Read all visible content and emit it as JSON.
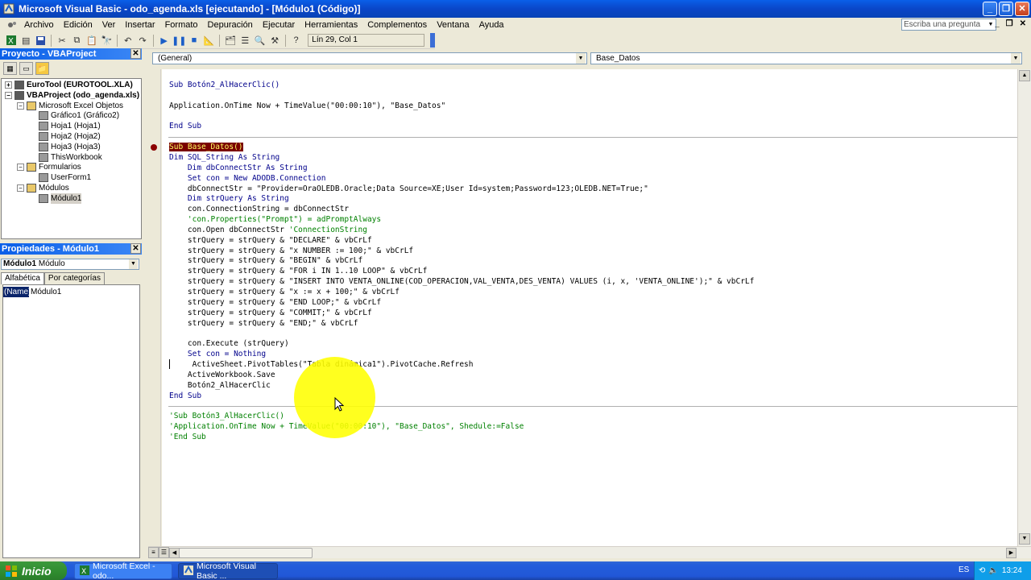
{
  "window": {
    "title": "Microsoft Visual Basic - odo_agenda.xls [ejecutando] - [Módulo1 (Código)]"
  },
  "menu": {
    "items": [
      "Archivo",
      "Edición",
      "Ver",
      "Insertar",
      "Formato",
      "Depuración",
      "Ejecutar",
      "Herramientas",
      "Complementos",
      "Ventana",
      "Ayuda"
    ],
    "ask_placeholder": "Escriba una pregunta"
  },
  "toolbar": {
    "position": "Lín 29, Col 1"
  },
  "project_panel": {
    "title": "Proyecto - VBAProject",
    "tree": [
      {
        "label": "EuroTool (EUROTOOL.XLA)",
        "level": 0,
        "bold": true,
        "expander": "+"
      },
      {
        "label": "VBAProject (odo_agenda.xls)",
        "level": 0,
        "bold": true,
        "expander": "−"
      },
      {
        "label": "Microsoft Excel Objetos",
        "level": 1,
        "expander": "−"
      },
      {
        "label": "Gráfico1 (Gráfico2)",
        "level": 2
      },
      {
        "label": "Hoja1 (Hoja1)",
        "level": 2
      },
      {
        "label": "Hoja2 (Hoja2)",
        "level": 2
      },
      {
        "label": "Hoja3 (Hoja3)",
        "level": 2
      },
      {
        "label": "ThisWorkbook",
        "level": 2
      },
      {
        "label": "Formularios",
        "level": 1,
        "expander": "−"
      },
      {
        "label": "UserForm1",
        "level": 2
      },
      {
        "label": "Módulos",
        "level": 1,
        "expander": "−"
      },
      {
        "label": "Módulo1",
        "level": 2,
        "selected": true
      }
    ]
  },
  "properties_panel": {
    "title": "Propiedades - Módulo1",
    "object_name": "Módulo1",
    "object_type": "Módulo",
    "tabs": [
      "Alfabética",
      "Por categorías"
    ],
    "rows": [
      {
        "name": "(Name)",
        "value": "Módulo1"
      }
    ]
  },
  "code_window": {
    "object_combo": "(General)",
    "proc_combo": "Base_Datos",
    "lines": [
      [
        {
          "t": "Sub Botón2_AlHacerClic()",
          "k": "kw"
        }
      ],
      [],
      [
        {
          "t": "Application.OnTime Now + TimeValue(\"00:00:10\"), \"Base_Datos\""
        }
      ],
      [],
      [
        {
          "t": "End Sub",
          "k": "kw"
        }
      ],
      [],
      [
        {
          "t": "Sub Base_Datos()",
          "k": "hl"
        }
      ],
      [
        {
          "t": "Dim SQL_String As String",
          "k": "kw"
        }
      ],
      [
        {
          "t": "    Dim dbConnectStr As String",
          "k": "kw"
        }
      ],
      [
        {
          "t": "    Set con = New ADODB.Connection",
          "k": "kw"
        }
      ],
      [
        {
          "t": "    dbConnectStr = \"Provider=OraOLEDB.Oracle;Data Source=XE;User Id=system;Password=123;OLEDB.NET=True;\""
        }
      ],
      [
        {
          "t": "    Dim strQuery As String",
          "k": "kw"
        }
      ],
      [
        {
          "t": "    con.ConnectionString = dbConnectStr"
        }
      ],
      [
        {
          "t": "    'con.Properties(\"Prompt\") = adPromptAlways",
          "k": "cm"
        }
      ],
      [
        {
          "t": "    con.Open dbConnectStr "
        },
        {
          "t": "'ConnectionString",
          "k": "cm"
        }
      ],
      [
        {
          "t": "    strQuery = strQuery & \"DECLARE\" & vbCrLf"
        }
      ],
      [
        {
          "t": "    strQuery = strQuery & \"x NUMBER := 100;\" & vbCrLf"
        }
      ],
      [
        {
          "t": "    strQuery = strQuery & \"BEGIN\" & vbCrLf"
        }
      ],
      [
        {
          "t": "    strQuery = strQuery & \"FOR i IN 1..10 LOOP\" & vbCrLf"
        }
      ],
      [
        {
          "t": "    strQuery = strQuery & \"INSERT INTO VENTA_ONLINE(COD_OPERACION,VAL_VENTA,DES_VENTA) VALUES (i, x, 'VENTA_ONLINE');\" & vbCrLf"
        }
      ],
      [
        {
          "t": "    strQuery = strQuery & \"x := x + 100;\" & vbCrLf"
        }
      ],
      [
        {
          "t": "    strQuery = strQuery & \"END LOOP;\" & vbCrLf"
        }
      ],
      [
        {
          "t": "    strQuery = strQuery & \"COMMIT;\" & vbCrLf"
        }
      ],
      [
        {
          "t": "    strQuery = strQuery & \"END;\" & vbCrLf"
        }
      ],
      [],
      [
        {
          "t": "    con.Execute (strQuery)"
        }
      ],
      [
        {
          "t": "    Set con = Nothing",
          "k": "kw"
        }
      ],
      [
        {
          "t": "     ActiveSheet.PivotTables(\"Tabla dinámica1\").PivotCache.Refresh"
        }
      ],
      [
        {
          "t": "    ActiveWorkbook.Save"
        }
      ],
      [
        {
          "t": "    Botón2_AlHacerClic"
        }
      ],
      [
        {
          "t": "End Sub",
          "k": "kw"
        }
      ],
      [],
      [
        {
          "t": "'Sub Botón3_AlHacerClic()",
          "k": "cm"
        }
      ],
      [
        {
          "t": "'Application.OnTime Now + TimeValue(\"00:00:10\"), \"Base_Datos\", Shedule:=False",
          "k": "cm"
        }
      ],
      [
        {
          "t": "'End Sub",
          "k": "cm"
        }
      ]
    ]
  },
  "taskbar": {
    "start_label": "Inicio",
    "tasks": [
      "Microsoft Excel - odo...",
      "Microsoft Visual Basic ..."
    ],
    "language": "ES",
    "clock": "13:24"
  }
}
